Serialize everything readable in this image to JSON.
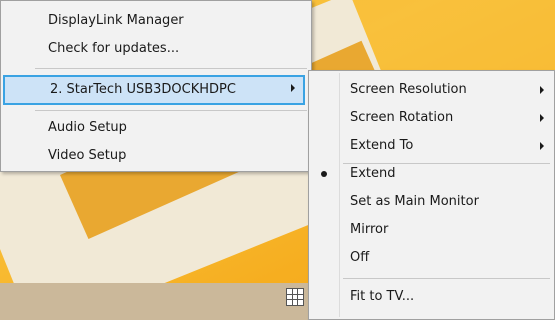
{
  "main_menu": {
    "items": [
      {
        "label": "DisplayLink Manager"
      },
      {
        "label": "Check for updates..."
      },
      {
        "label": "2. StarTech USB3DOCKHDPC"
      },
      {
        "label": "Audio Setup"
      },
      {
        "label": "Video Setup"
      }
    ]
  },
  "sub_menu": {
    "items": [
      {
        "label": "Screen Resolution"
      },
      {
        "label": "Screen Rotation"
      },
      {
        "label": "Extend To"
      },
      {
        "label": "Extend"
      },
      {
        "label": "Set as Main Monitor"
      },
      {
        "label": "Mirror"
      },
      {
        "label": "Off"
      },
      {
        "label": "Fit to TV..."
      }
    ]
  },
  "taskbar": {
    "tray_icon": "displaylink-grid-icon"
  },
  "colors": {
    "highlight_bg": "#cde3f7",
    "highlight_border": "#3aa3e3",
    "menu_bg": "#f2f2f2",
    "wallpaper": "#f7b32a"
  }
}
